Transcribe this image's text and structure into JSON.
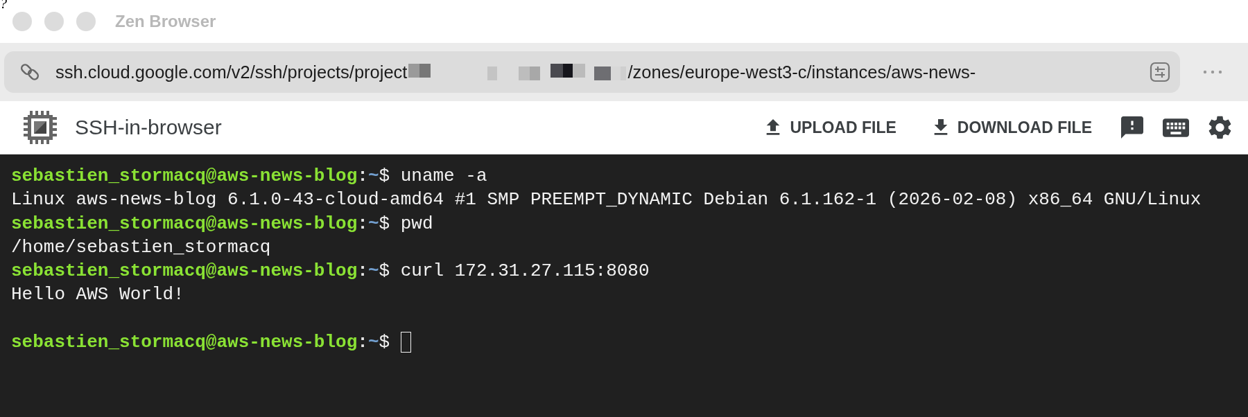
{
  "window": {
    "corner_mark": "?",
    "title": "Zen Browser"
  },
  "address_bar": {
    "url_start": "ssh.cloud.google.com/v2/ssh/projects/project",
    "url_end": "/zones/europe-west3-c/instances/aws-news-"
  },
  "app_header": {
    "title": "SSH-in-browser",
    "actions": [
      {
        "kind": "upload",
        "label": "UPLOAD FILE"
      },
      {
        "kind": "download",
        "label": "DOWNLOAD FILE"
      }
    ]
  },
  "terminal": {
    "lines": [
      {
        "kind": "prompt",
        "user_host": "sebastien_stormacq@aws-news-blog",
        "separator": ":",
        "path": "~",
        "symbol": "$",
        "command": "uname -a",
        "cursor": false
      },
      {
        "kind": "output",
        "text": "Linux aws-news-blog 6.1.0-43-cloud-amd64 #1 SMP PREEMPT_DYNAMIC Debian 6.1.162-1 (2026-02-08) x86_64 GNU/Linux"
      },
      {
        "kind": "prompt",
        "user_host": "sebastien_stormacq@aws-news-blog",
        "separator": ":",
        "path": "~",
        "symbol": "$",
        "command": "pwd",
        "cursor": false
      },
      {
        "kind": "output",
        "text": "/home/sebastien_stormacq"
      },
      {
        "kind": "prompt",
        "user_host": "sebastien_stormacq@aws-news-blog",
        "separator": ":",
        "path": "~",
        "symbol": "$",
        "command": "curl 172.31.27.115:8080",
        "cursor": false
      },
      {
        "kind": "output",
        "text": "Hello AWS World!"
      },
      {
        "kind": "blank"
      },
      {
        "kind": "prompt",
        "user_host": "sebastien_stormacq@aws-news-blog",
        "separator": ":",
        "path": "~",
        "symbol": "$",
        "cursor": true
      }
    ]
  }
}
